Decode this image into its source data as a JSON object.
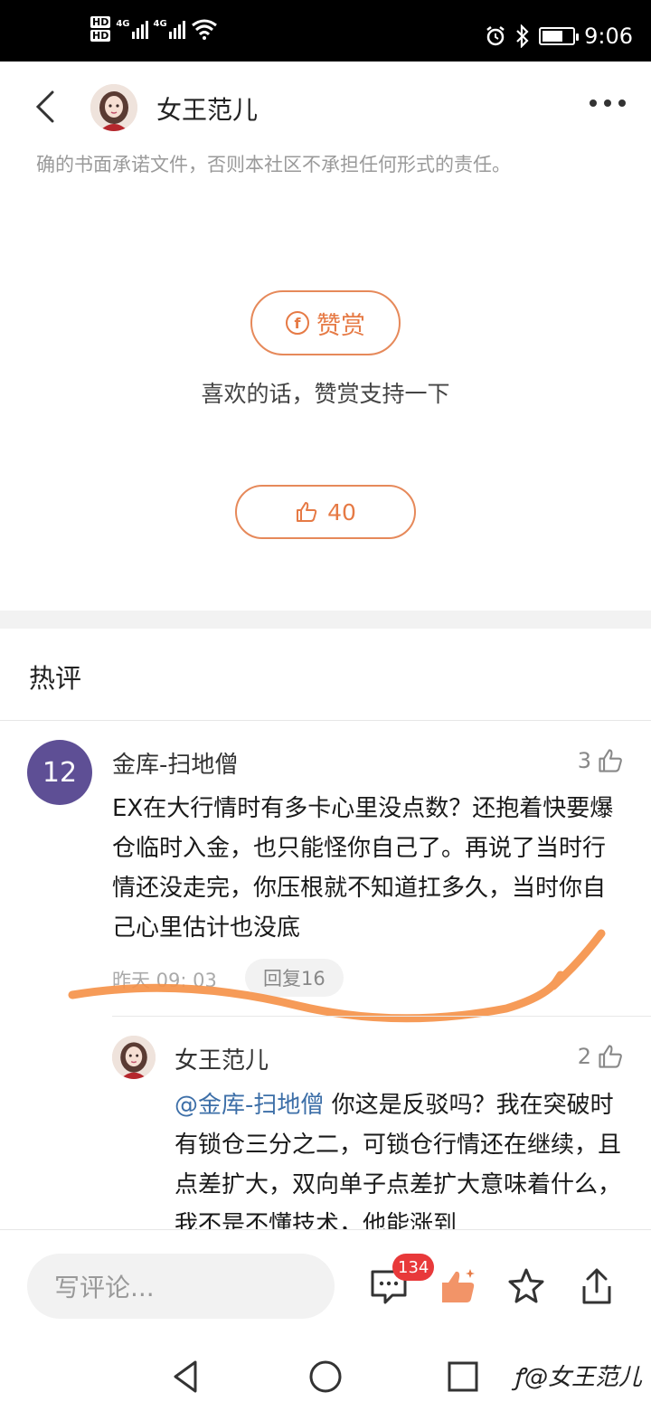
{
  "status_bar": {
    "hd1": "HD",
    "hd2": "HD",
    "sig1": "4G",
    "sig2": "4G",
    "time": "9:06"
  },
  "header": {
    "author_name": "女王范儿"
  },
  "article": {
    "disclaimer": "确的书面承诺文件，否则本社区不承担任何形式的责任。",
    "reward_label": "赞赏",
    "reward_icon_glyph": "f",
    "reward_hint": "喜欢的话，赞赏支持一下",
    "like_count": "40"
  },
  "hot_comments": {
    "title": "热评",
    "comment": {
      "avatar_text": "12",
      "author": "金库-扫地僧",
      "likes": "3",
      "body": "EX在大行情时有多卡心里没点数？还抱着快要爆仓临时入金，也只能怪你自己了。再说了当时行情还没走完，你压根就不知道扛多久，当时你自己心里估计也没底",
      "time": "昨天 09: 03",
      "reply_label": "回复16"
    },
    "reply": {
      "author": "女王范儿",
      "likes": "2",
      "mention": "@金库-扫地僧",
      "body": " 你这是反驳吗？我在突破时有锁仓三分之二，可锁仓行情还在继续，且点差扩大，双向单子点差扩大意味着什么，我不是不懂技术，他能涨到"
    }
  },
  "bottom_bar": {
    "input_placeholder": "写评论...",
    "comment_badge": "134"
  },
  "watermark": "@女王范儿",
  "colors": {
    "accent": "#e67a45",
    "avatar_purple": "#5e4f95",
    "badge_red": "#e8393a",
    "mention_blue": "#3d6fa8",
    "scribble_orange": "#f5924a"
  }
}
